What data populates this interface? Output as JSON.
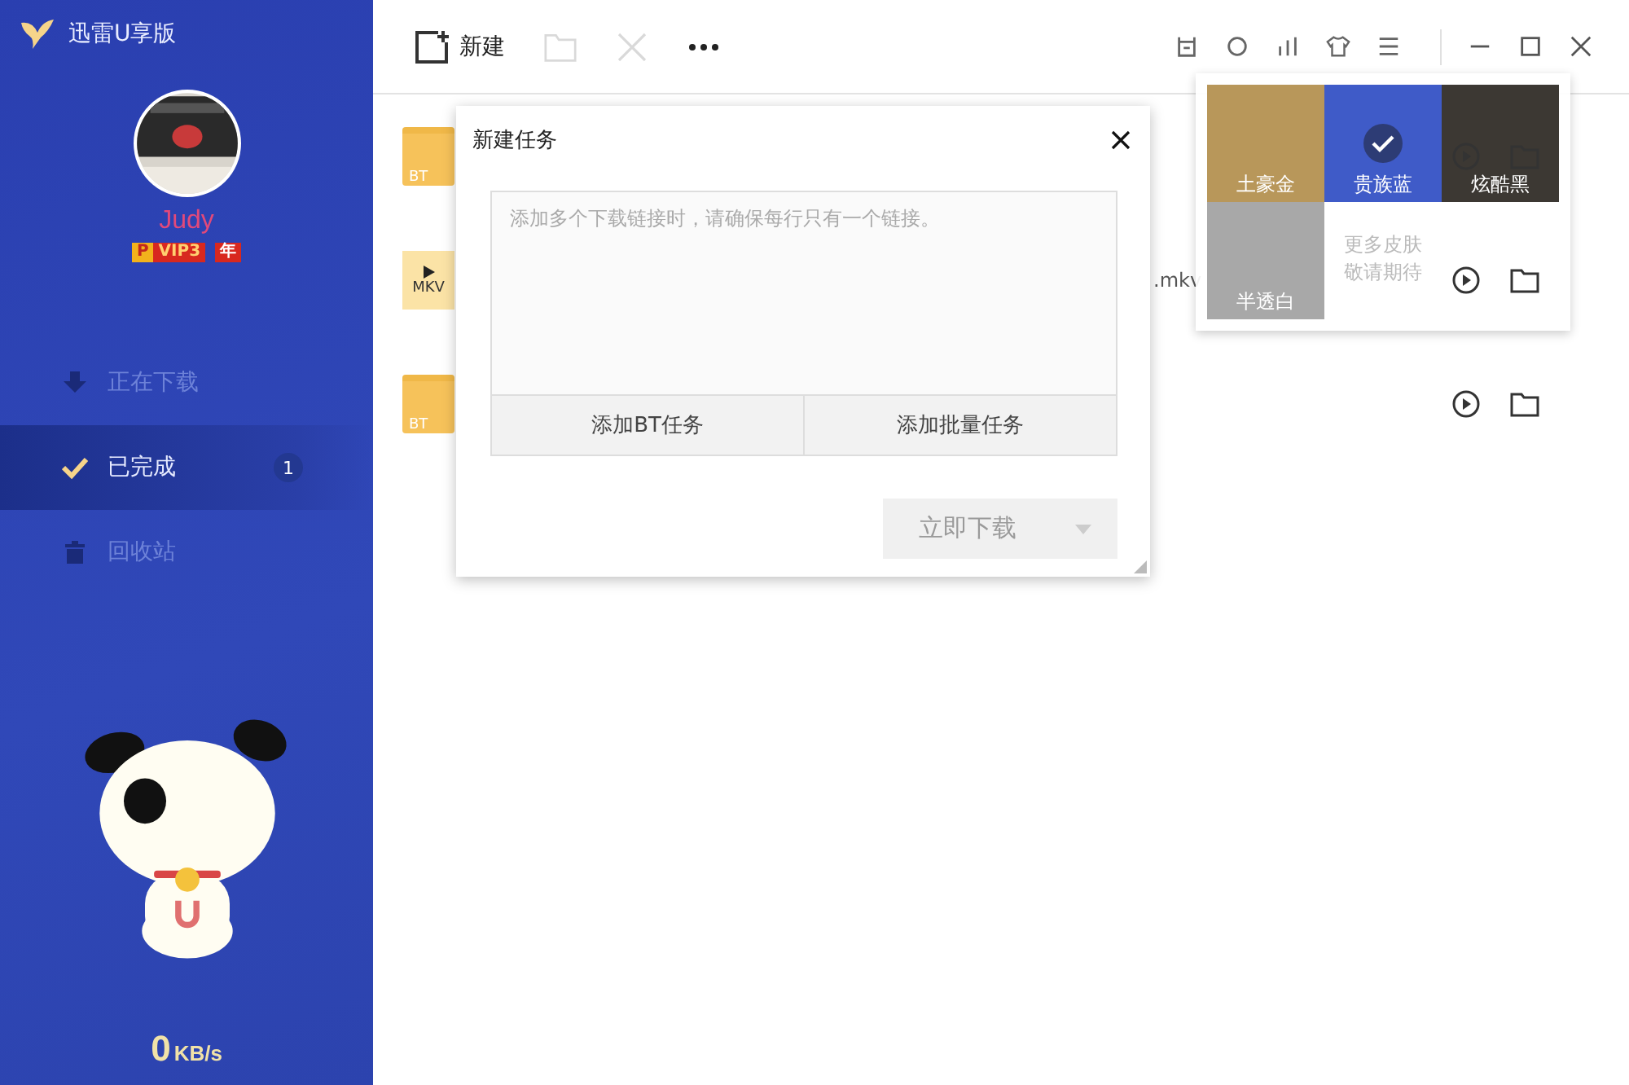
{
  "app": {
    "title": "迅雷U享版"
  },
  "user": {
    "name": "Judy",
    "badges": [
      {
        "kind": "p",
        "text": "P"
      },
      {
        "kind": "vip",
        "text": "VIP3"
      },
      {
        "kind": "year",
        "text": "年"
      }
    ]
  },
  "nav": [
    {
      "label": "正在下载",
      "kind": "download",
      "selected": false
    },
    {
      "label": "已完成",
      "kind": "done",
      "selected": true,
      "count": "1"
    },
    {
      "label": "回收站",
      "kind": "trash",
      "selected": false
    }
  ],
  "speed": {
    "value": "0",
    "unit": "KB/s"
  },
  "toolbar": [
    {
      "kind": "new",
      "label": "新建",
      "disabled": false
    },
    {
      "kind": "folder",
      "disabled": true
    },
    {
      "kind": "delete",
      "disabled": true
    },
    {
      "kind": "more",
      "disabled": false
    }
  ],
  "tasks": [
    {
      "kind": "folder",
      "tag": "BT"
    },
    {
      "kind": "video",
      "tag": "MKV",
      "name": ".mkv"
    },
    {
      "kind": "folder",
      "tag": "BT"
    }
  ],
  "dialog": {
    "title": "新建任务",
    "placeholder": "添加多个下载链接时，请确保每行只有一个链接。",
    "buttons": [
      "添加BT任务",
      "添加批量任务"
    ],
    "primary": {
      "label": "立即下载",
      "disabled": true
    }
  },
  "skins": [
    {
      "label": "土豪金",
      "color": "#b8975a",
      "selected": false
    },
    {
      "label": "贵族蓝",
      "color": "#3f5bc8",
      "selected": true
    },
    {
      "label": "炫酷黑",
      "color": "#3c3833",
      "selected": false
    },
    {
      "label": "半透白",
      "color": "#a8a8a8",
      "selected": false
    }
  ],
  "skins_more": [
    "更多皮肤",
    "敬请期待"
  ]
}
